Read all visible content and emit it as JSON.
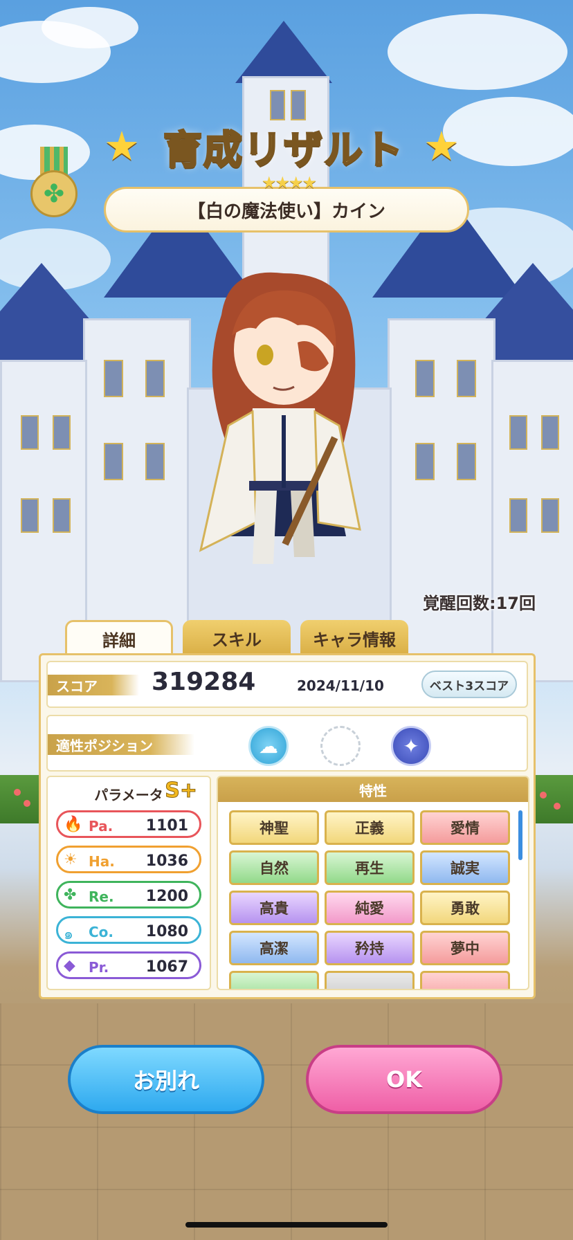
{
  "header": {
    "title": "育成リザルト",
    "rarity_stars": "★★★★",
    "character_name": "【白の魔法使い】カイン"
  },
  "awakening": "覚醒回数:17回",
  "tabs": [
    {
      "label": "詳細",
      "active": true
    },
    {
      "label": "スキル",
      "active": false
    },
    {
      "label": "キャラ情報",
      "active": false
    }
  ],
  "score": {
    "label": "スコア",
    "value": "319284",
    "date": "2024/11/10",
    "best_button": "ベスト3スコア"
  },
  "position": {
    "label": "適性ポジション",
    "icons": [
      "cloud-icon",
      "empty-slot",
      "rocket-icon"
    ]
  },
  "params": {
    "title": "パラメータ",
    "rank": "S+",
    "items": [
      {
        "name": "Pa.",
        "value": "1101",
        "color": "#e8555a",
        "icon": "flame-icon"
      },
      {
        "name": "Ha.",
        "value": "1036",
        "color": "#f0a030",
        "icon": "sun-icon"
      },
      {
        "name": "Re.",
        "value": "1200",
        "color": "#3fb45c",
        "icon": "clover-icon"
      },
      {
        "name": "Co.",
        "value": "1080",
        "color": "#3bb3d6",
        "icon": "swirl-icon"
      },
      {
        "name": "Pr.",
        "value": "1067",
        "color": "#8a5ad6",
        "icon": "diamond-icon"
      }
    ]
  },
  "traits": {
    "title": "特性",
    "items": [
      "神聖",
      "正義",
      "愛情",
      "自然",
      "再生",
      "誠実",
      "高貴",
      "純愛",
      "勇敢",
      "高潔",
      "矜持",
      "夢中"
    ]
  },
  "buttons": {
    "farewell": "お別れ",
    "ok": "OK"
  }
}
